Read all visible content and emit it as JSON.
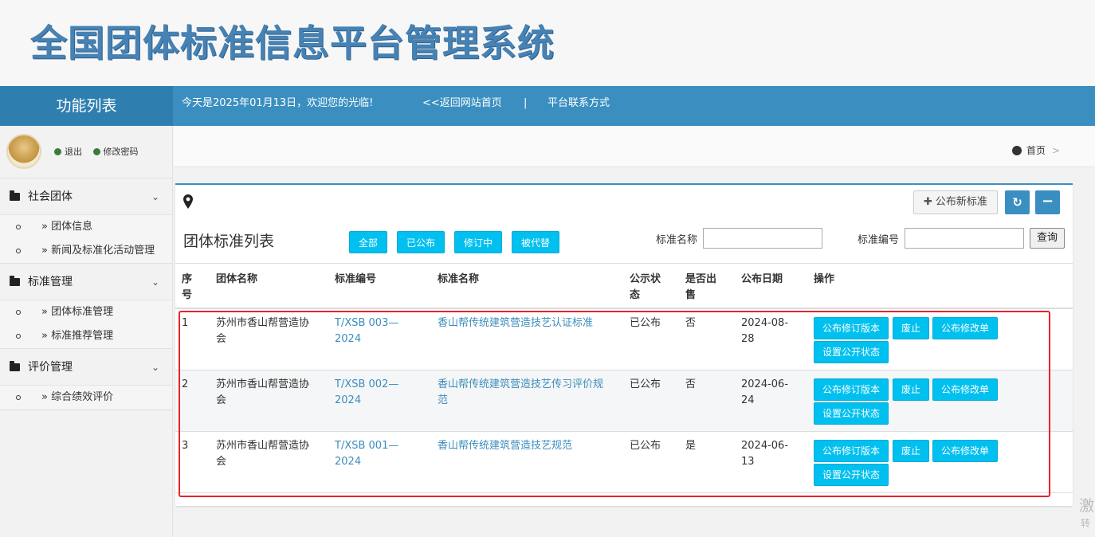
{
  "header": {
    "title": "全国团体标准信息平台管理系统"
  },
  "topbar": {
    "side_title": "功能列表",
    "welcome": "今天是2025年01月13日，欢迎您的光临!",
    "back_home": "<<返回网站首页",
    "separator": "|",
    "contact": "平台联系方式"
  },
  "user": {
    "logout": "退出",
    "change_password": "修改密码"
  },
  "sidebar": {
    "groups": [
      {
        "label": "社会团体",
        "items": [
          "» 团体信息",
          "» 新闻及标准化活动管理"
        ]
      },
      {
        "label": "标准管理",
        "items": [
          "» 团体标准管理",
          "» 标准推荐管理"
        ]
      },
      {
        "label": "评价管理",
        "items": [
          "» 综合绩效评价"
        ]
      }
    ]
  },
  "breadcrumb": {
    "home": "首页",
    "gt": ">"
  },
  "panel": {
    "new_button": "公布新标准",
    "refresh_icon": "refresh-icon",
    "minus_icon": "minus-icon",
    "title": "团体标准列表",
    "filters": [
      "全部",
      "已公布",
      "修订中",
      "被代替"
    ],
    "search": {
      "name_label": "标准名称",
      "name_value": "",
      "code_label": "标准编号",
      "code_value": "",
      "query_button": "查询"
    }
  },
  "table": {
    "headers": [
      "序号",
      "团体名称",
      "标准编号",
      "标准名称",
      "公示状态",
      "是否出售",
      "公布日期",
      "操作"
    ],
    "header_lines": {
      "seq": [
        "序",
        "号"
      ],
      "status": [
        "公示状",
        "态"
      ],
      "sale": [
        "是否出",
        "售"
      ]
    },
    "rows": [
      {
        "seq": "1",
        "org": [
          "苏州市香山帮营造协",
          "会"
        ],
        "code": [
          "T/XSB 003—",
          "2024"
        ],
        "name": [
          "香山帮传统建筑营造技艺认证标准"
        ],
        "status": "已公布",
        "sale": "否",
        "date": [
          "2024-08-",
          "28"
        ]
      },
      {
        "seq": "2",
        "org": [
          "苏州市香山帮营造协",
          "会"
        ],
        "code": [
          "T/XSB 002—",
          "2024"
        ],
        "name": [
          "香山帮传统建筑营造技艺传习评价规",
          "范"
        ],
        "status": "已公布",
        "sale": "否",
        "date": [
          "2024-06-",
          "24"
        ]
      },
      {
        "seq": "3",
        "org": [
          "苏州市香山帮营造协",
          "会"
        ],
        "code": [
          "T/XSB 001—",
          "2024"
        ],
        "name": [
          "香山帮传统建筑营造技艺规范"
        ],
        "status": "已公布",
        "sale": "是",
        "date": [
          "2024-06-",
          "13"
        ]
      }
    ],
    "actions": [
      "公布修订版本",
      "废止",
      "公布修改单",
      "设置公开状态"
    ]
  },
  "watermark": {
    "line1": "激",
    "line2": "转"
  },
  "colors": {
    "primary": "#3a8fc0",
    "action": "#00c0ef",
    "link": "#3c8dbc",
    "highlight": "#e8222b"
  }
}
